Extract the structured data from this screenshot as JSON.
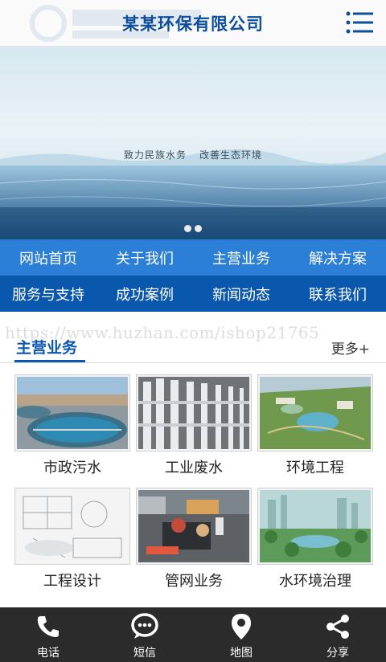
{
  "header": {
    "title": "某某环保有限公司"
  },
  "banner": {
    "tagline_left": "致力民族水务",
    "tagline_right": "改善生态环境",
    "dots": 2,
    "active_dot": 1
  },
  "nav": {
    "row1": [
      "网站首页",
      "关于我们",
      "主营业务",
      "解决方案"
    ],
    "row2": [
      "服务与支持",
      "成功案例",
      "新闻动态",
      "联系我们"
    ]
  },
  "watermark_url": "https://www.huzhan.com/ishop21765",
  "section": {
    "title": "主营业务",
    "more": "更多+"
  },
  "products": [
    {
      "label": "市政污水",
      "icon": "treatment-tank-photo"
    },
    {
      "label": "工业废水",
      "icon": "membrane-pipes-photo"
    },
    {
      "label": "环境工程",
      "icon": "landscape-plan-photo"
    },
    {
      "label": "工程设计",
      "icon": "blueprint-photo"
    },
    {
      "label": "管网业务",
      "icon": "pipe-inspection-photo"
    },
    {
      "label": "水环境治理",
      "icon": "green-city-photo"
    }
  ],
  "footer": {
    "items": [
      {
        "label": "电话",
        "icon": "phone-icon"
      },
      {
        "label": "短信",
        "icon": "message-icon"
      },
      {
        "label": "地图",
        "icon": "map-pin-icon"
      },
      {
        "label": "分享",
        "icon": "share-icon"
      }
    ]
  },
  "colors": {
    "brand": "#0a57ae",
    "nav_light": "#2b7fd6",
    "footer_bg": "#2b2b2b"
  }
}
